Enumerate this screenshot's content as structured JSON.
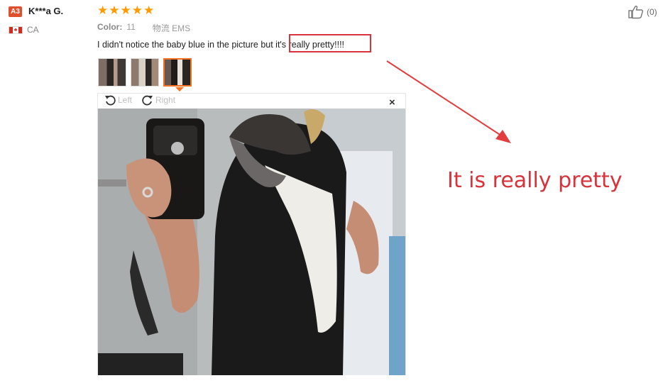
{
  "reviewer": {
    "badge": "A3",
    "name": "K***a G.",
    "country": "CA"
  },
  "rating": {
    "stars": 5
  },
  "attributes": {
    "color_key": "Color:",
    "color_value": "11",
    "shipping": "物流 EMS"
  },
  "review": {
    "text": "I didn't notice the baby blue in the picture but it's really pretty!!!!"
  },
  "thumbnails": [
    "review-photo-1",
    "review-photo-2",
    "review-photo-3"
  ],
  "viewer": {
    "left_label": "Left",
    "right_label": "Right",
    "close_label": "×"
  },
  "helpful": {
    "count_label": "(0)"
  },
  "annotation": {
    "callout_text": "It is really pretty"
  },
  "colors": {
    "accent": "#f57224",
    "star": "#ff9a00",
    "annotation_red": "#d8323a"
  }
}
